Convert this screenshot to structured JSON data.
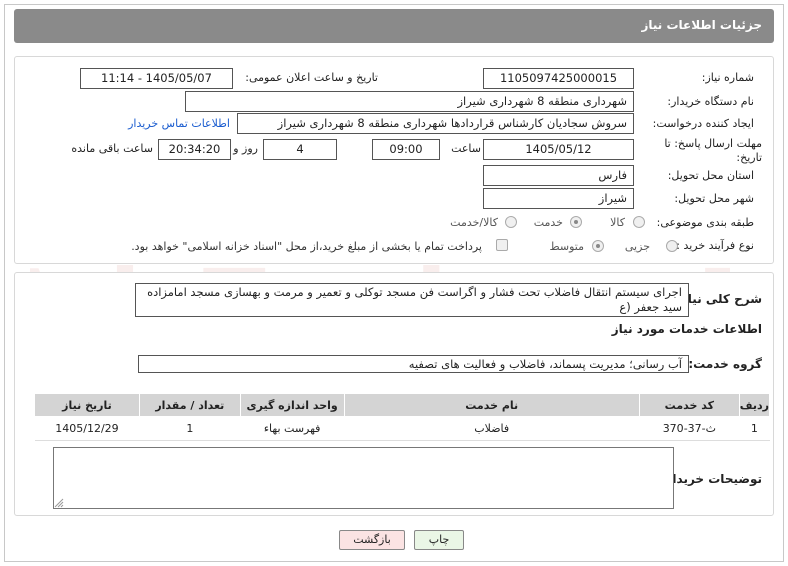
{
  "header": {
    "title": "جزئیات اطلاعات نیاز"
  },
  "fields": {
    "need_number_label": "شماره نیاز:",
    "need_number": "1105097425000015",
    "announce_label": "تاریخ و ساعت اعلان عمومی:",
    "announce_value": "1405/05/07 - 11:14",
    "buyer_org_label": "نام دستگاه خریدار:",
    "buyer_org": "شهرداری منطقه 8 شهرداری شیراز",
    "creator_label": "ایجاد کننده درخواست:",
    "creator": "سروش سجادیان کارشناس قراردادها شهرداری منطقه 8 شهرداری شیراز",
    "contact_link": "اطلاعات تماس خریدار",
    "deadline_label": "مهلت ارسال پاسخ: تا تاریخ:",
    "deadline_date": "1405/05/12",
    "time_label": "ساعت",
    "deadline_time": "09:00",
    "days_value": "4",
    "days_label": "روز و",
    "remaining_time": "20:34:20",
    "remaining_label": "ساعت باقی مانده",
    "province_label": "استان محل تحویل:",
    "province": "فارس",
    "city_label": "شهر محل تحویل:",
    "city": "شیراز",
    "category_label": "طبقه بندی موضوعی:",
    "category_options": [
      "کالا",
      "خدمت",
      "کالا/خدمت"
    ],
    "process_label": "نوع فرآیند خرید :",
    "process_options": [
      "جزیی",
      "متوسط"
    ],
    "payment_note": "پرداخت تمام یا بخشی از مبلغ خرید،از محل \"اسناد خزانه اسلامی\" خواهد بود."
  },
  "summary": {
    "label": "شرح کلی نیاز:",
    "text": "اجرای سیستم انتقال فاضلاب تحت فشار و اگراست فن مسجد توکلی و تعمیر و مرمت و بهسازی مسجد امامزاده سید جعفر (ع"
  },
  "services": {
    "section_title": "اطلاعات خدمات مورد نیاز",
    "group_label": "گروه خدمت:",
    "group_value": "آب رسانی؛ مدیریت پسماند، فاضلاب و فعالیت های تصفیه",
    "columns": [
      "ردیف",
      "کد خدمت",
      "نام خدمت",
      "واحد اندازه گیری",
      "تعداد / مقدار",
      "تاریخ نیاز"
    ],
    "rows": [
      [
        "1",
        "ث-37-370",
        "فاضلاب",
        "فهرست بهاء",
        "1",
        "1405/12/29"
      ]
    ]
  },
  "buyer_notes": {
    "label": "توضیحات خریدار:",
    "value": ""
  },
  "buttons": {
    "print": "چاپ",
    "back": "بازگشت"
  },
  "watermark": "AriaTender.neT",
  "colors": {
    "header": "#8a8a8a",
    "link": "#1a5ccf",
    "back_button": "#fbe3e3",
    "print_button": "#eaf6e6"
  }
}
